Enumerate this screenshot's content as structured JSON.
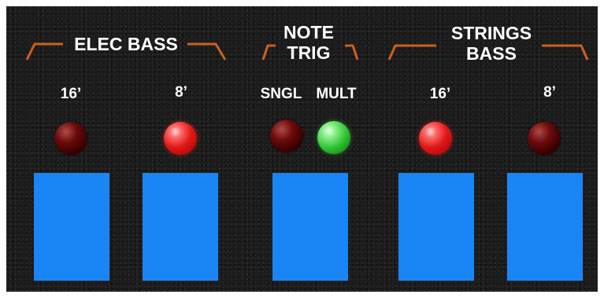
{
  "groups": {
    "elec_bass": {
      "label": "ELEC BASS"
    },
    "note_trig": {
      "line1": "NOTE",
      "line2": "TRIG"
    },
    "strings_bass": {
      "line1": "STRINGS",
      "line2": "BASS"
    }
  },
  "channels": [
    {
      "label": "16’",
      "led": "off"
    },
    {
      "label": "8’",
      "led": "on"
    },
    {
      "label": "SNGL",
      "led": "off"
    },
    {
      "label": "MULT",
      "led": "on"
    },
    {
      "label": "16’",
      "led": "on"
    },
    {
      "label": "8’",
      "led": "off"
    }
  ],
  "colors": {
    "panel": "#1c1c1c",
    "label_text": "#ffffff",
    "bracket": "#c8621e",
    "button": "#1a86f5",
    "led_red": "#e01818",
    "led_green": "#2fc22f"
  }
}
